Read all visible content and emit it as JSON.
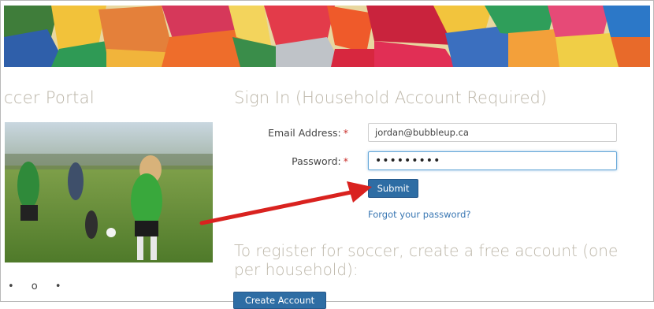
{
  "portal": {
    "left_title": "ccer Portal",
    "carousel_indicators": "• o •"
  },
  "signin": {
    "title": "Sign In (Household Account Required)",
    "email_label": "Email Address:",
    "email_value": "jordan@bubbleup.ca",
    "password_label": "Password:",
    "password_value": "•••••••••",
    "required_marker": "*",
    "submit_label": "Submit",
    "forgot_link": "Forgot your password?"
  },
  "register": {
    "text": "To register for soccer, create a free account (one per household):",
    "button_label": "Create Account"
  },
  "icons": {
    "annotation": "red-arrow-icon"
  }
}
